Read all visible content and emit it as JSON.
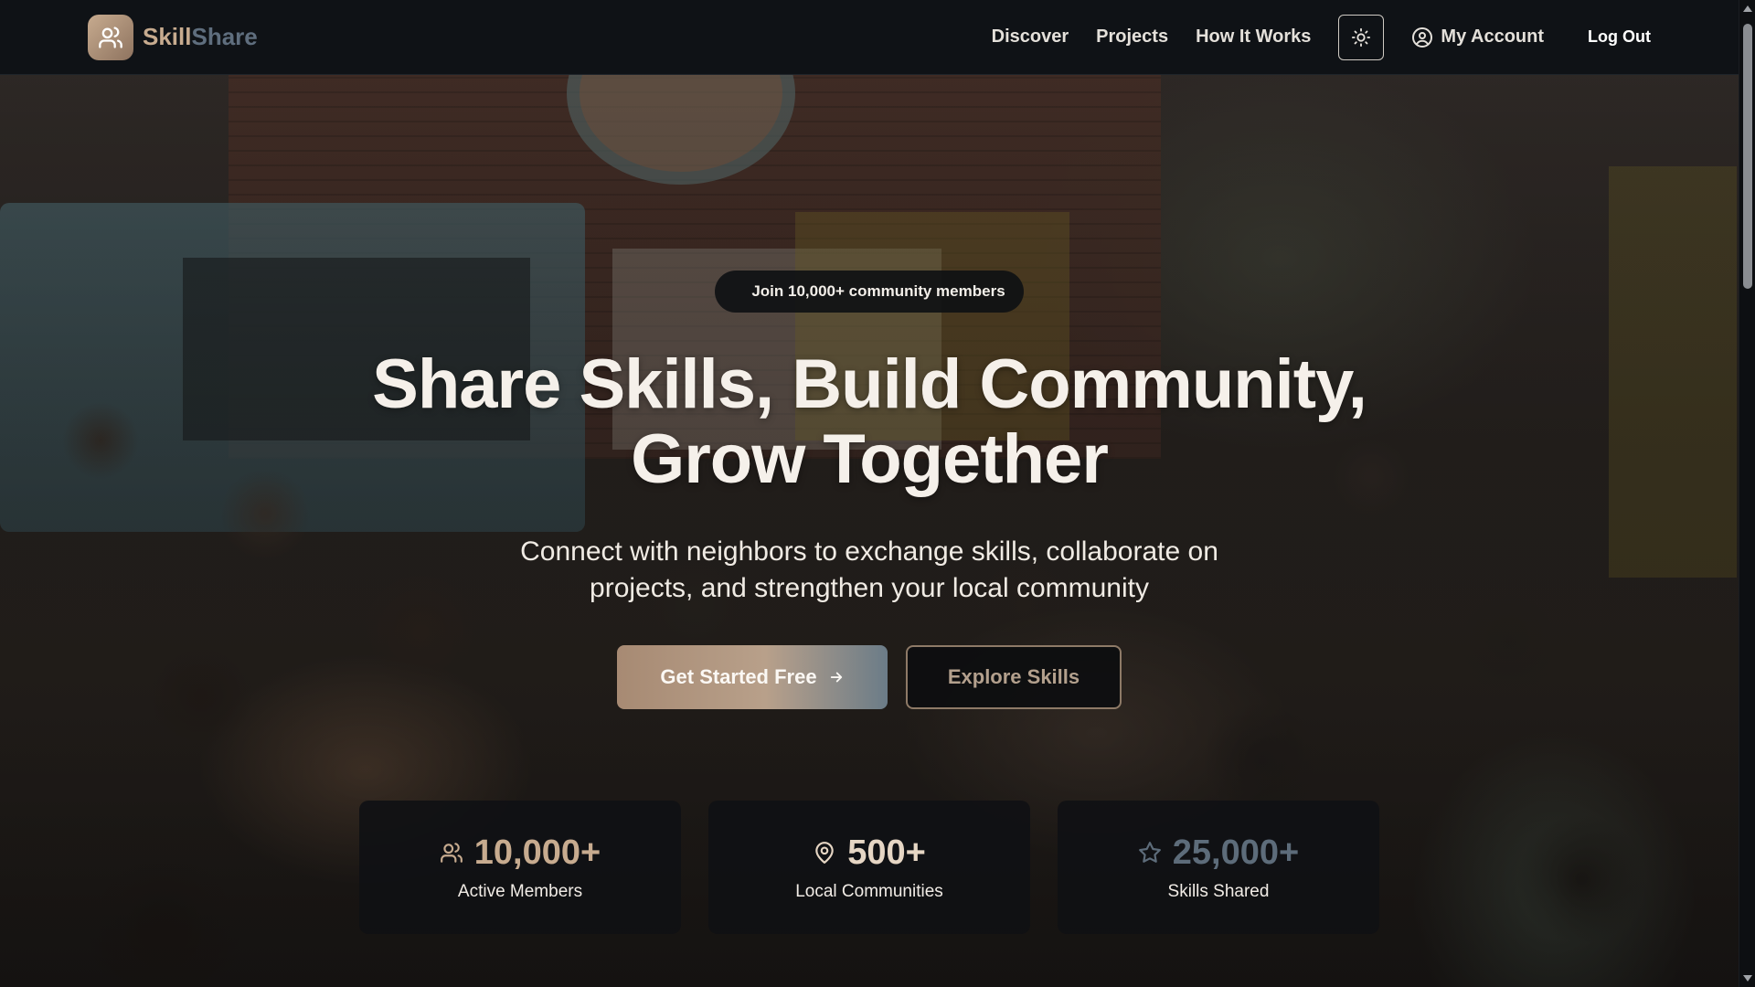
{
  "nav": {
    "brand_skill": "Skill",
    "brand_share": "Share",
    "links": [
      "Discover",
      "Projects",
      "How It Works"
    ],
    "account_label": "My Account",
    "logout_label": "Log Out"
  },
  "hero": {
    "badge": "Join 10,000+ community members",
    "headline_line1": "Share Skills, Build Community,",
    "headline_line2": "Grow Together",
    "subhead": "Connect with neighbors to exchange skills, collaborate on projects, and strengthen your local community",
    "cta_primary": "Get Started Free",
    "cta_secondary": "Explore Skills"
  },
  "stats": [
    {
      "value": "10,000+",
      "label": "Active Members",
      "icon": "users-icon"
    },
    {
      "value": "500+",
      "label": "Local Communities",
      "icon": "map-pin-icon"
    },
    {
      "value": "25,000+",
      "label": "Skills Shared",
      "icon": "star-icon"
    }
  ],
  "colors": {
    "accent": "#c7ab8f",
    "accent_dark": "#8e735f",
    "slate": "#5f6e7e",
    "nav_bg": "#0f1216"
  }
}
